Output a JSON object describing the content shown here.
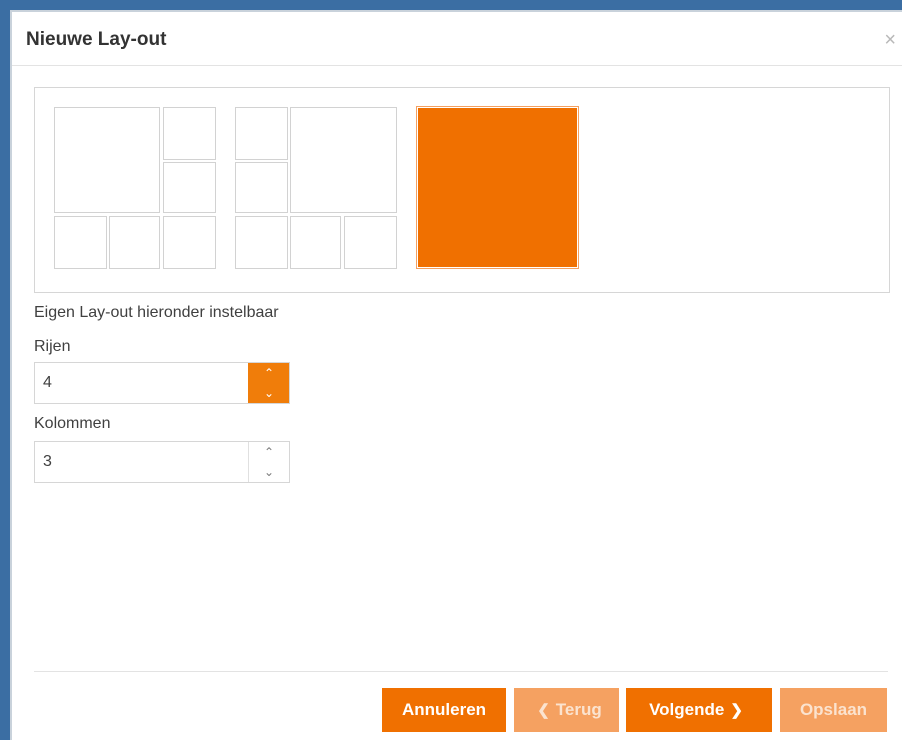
{
  "dialog": {
    "title": "Nieuwe Lay-out",
    "close_icon": "×"
  },
  "presets": [
    {
      "name": "layout-large-top-left",
      "selected": false
    },
    {
      "name": "layout-large-top-right",
      "selected": false
    },
    {
      "name": "layout-single",
      "selected": true
    }
  ],
  "form": {
    "hint": "Eigen Lay-out hieronder instelbaar",
    "rows_label": "Rijen",
    "rows_value": "4",
    "columns_label": "Kolommen",
    "columns_value": "3",
    "spin_up": "⌃",
    "spin_down": "⌄"
  },
  "buttons": {
    "cancel": "Annuleren",
    "back": "Terug",
    "next": "Volgende",
    "save": "Opslaan",
    "back_chevron": "❮",
    "next_chevron": "❯"
  },
  "colors": {
    "accent": "#f07000",
    "accent_disabled": "#f5a161",
    "backdrop": "#3b6ea3"
  }
}
